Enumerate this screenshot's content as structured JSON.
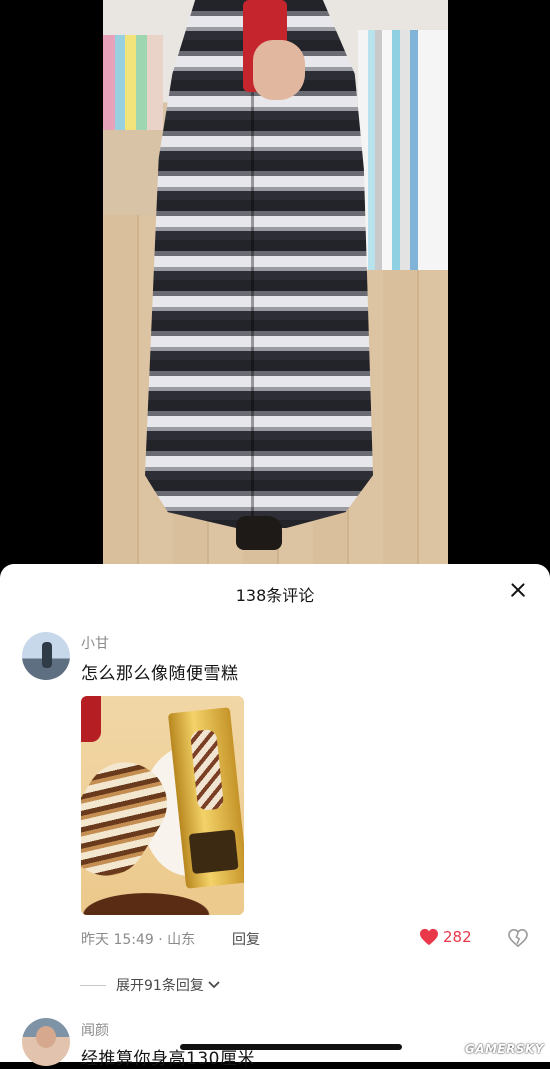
{
  "header": {
    "title": "138条评论"
  },
  "comments": [
    {
      "username": "小甘",
      "text": "怎么那么像随便雪糕",
      "meta": "昨天 15:49 · 山东",
      "reply_label": "回复",
      "likes": "282",
      "expand_label": "展开91条回复"
    },
    {
      "username": "闻颜",
      "text": "经推算你身高130厘米"
    }
  ],
  "watermark": "GAMERSKY",
  "colors": {
    "like": "#e8384a",
    "muted_text": "#8a8a8a",
    "sheet_background": "#ffffff"
  }
}
